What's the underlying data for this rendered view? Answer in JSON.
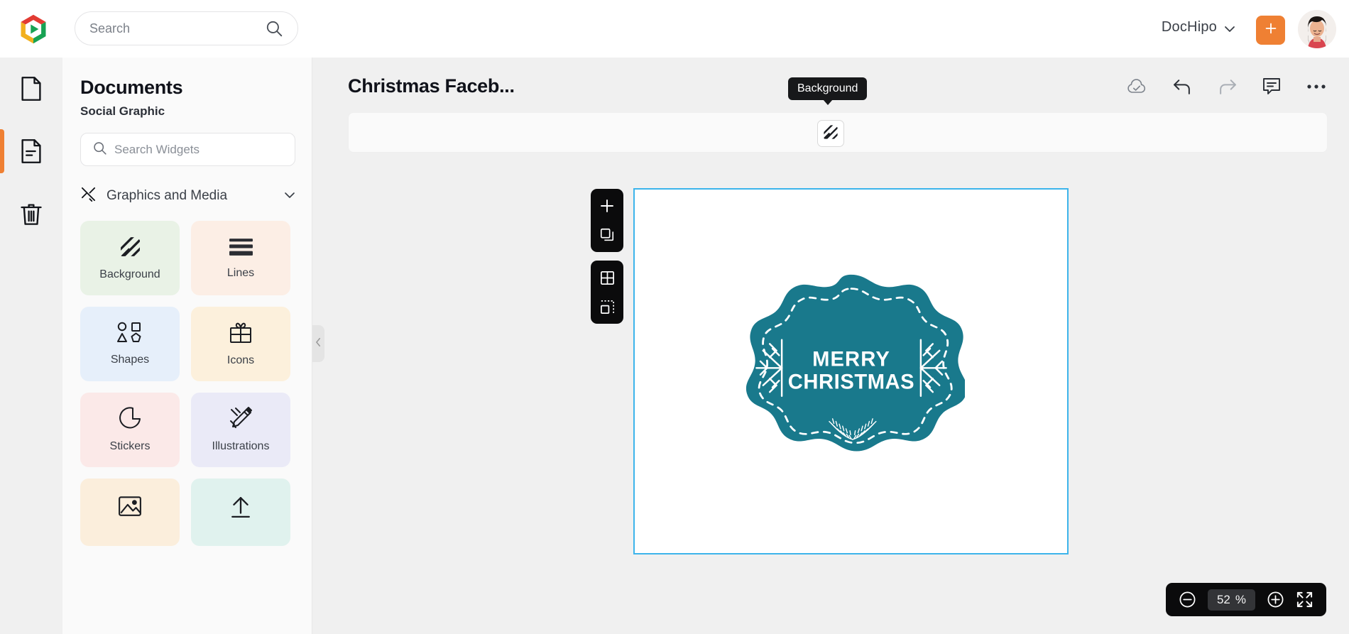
{
  "topbar": {
    "logo_icon": "dochipo-play-logo",
    "search": {
      "placeholder": "Search",
      "value": "",
      "icon": "search-icon"
    },
    "account_name": "DocHipo",
    "account_caret_icon": "chevron-down-icon",
    "add_button_icon": "plus-icon",
    "avatar_alt": "user-avatar"
  },
  "rail": {
    "items": [
      {
        "name": "blank-page",
        "icon": "page-icon",
        "active": false
      },
      {
        "name": "documents",
        "icon": "document-lines-icon",
        "active": true
      },
      {
        "name": "trash",
        "icon": "trash-icon",
        "active": false
      }
    ]
  },
  "panel": {
    "title": "Documents",
    "subtitle": "Social Graphic",
    "search": {
      "placeholder": "Search Widgets",
      "value": "",
      "icon": "search-icon"
    },
    "section": {
      "label": "Graphics and Media",
      "icon": "graphics-media-icon",
      "caret": "chevron-down-icon"
    },
    "collapse_handle_icon": "chevron-left-icon",
    "cards": [
      {
        "label": "Background",
        "icon": "diagonal-stripes-icon",
        "bg": "#e9f2e6"
      },
      {
        "label": "Lines",
        "icon": "lines-icon",
        "bg": "#fceee5"
      },
      {
        "label": "Shapes",
        "icon": "shapes-icon",
        "bg": "#e6effa"
      },
      {
        "label": "Icons",
        "icon": "gift-icon",
        "bg": "#fcf0dc"
      },
      {
        "label": "Stickers",
        "icon": "sticker-icon",
        "bg": "#fbe9e8"
      },
      {
        "label": "Illustrations",
        "icon": "pencil-ruler-icon",
        "bg": "#eaeaf7"
      },
      {
        "label": "",
        "icon": "image-icon",
        "bg": "#fbeedc"
      },
      {
        "label": "",
        "icon": "upload-icon",
        "bg": "#e0f2ee"
      }
    ]
  },
  "editor": {
    "document_title": "Christmas Faceb...",
    "top_icons": [
      {
        "name": "cloud-saved-icon",
        "label": "cloud-check"
      },
      {
        "name": "undo-icon",
        "label": "undo"
      },
      {
        "name": "redo-icon",
        "label": "redo"
      },
      {
        "name": "comment-icon",
        "label": "comment"
      },
      {
        "name": "more-options-icon",
        "label": "ellipsis"
      }
    ],
    "ribbon": {
      "background_button_icon": "diagonal-stripes-icon",
      "tooltip": "Background"
    },
    "page_tools": [
      [
        {
          "name": "add-page-button",
          "icon": "plus-icon"
        },
        {
          "name": "duplicate-page-button",
          "icon": "copy-icon"
        }
      ],
      [
        {
          "name": "grid-button",
          "icon": "grid-icon"
        },
        {
          "name": "snap-button",
          "icon": "snap-icon"
        }
      ]
    ],
    "zoom": {
      "out_icon": "minus-circle-icon",
      "level": "52",
      "unit": "%",
      "in_icon": "plus-circle-icon",
      "fullscreen_icon": "fullscreen-icon"
    }
  },
  "canvas": {
    "selection_color": "#3cb4eb",
    "artwork": {
      "type": "christmas-badge",
      "shape": "scalloped-circle",
      "fill_color": "#19798c",
      "dashed_border_color": "#ffffff",
      "text_lines": [
        "MERRY",
        "CHRISTMAS"
      ],
      "text_color": "#ffffff",
      "decorations": [
        "snowflake-left",
        "snowflake-right",
        "laurel-branch-bottom"
      ]
    }
  }
}
